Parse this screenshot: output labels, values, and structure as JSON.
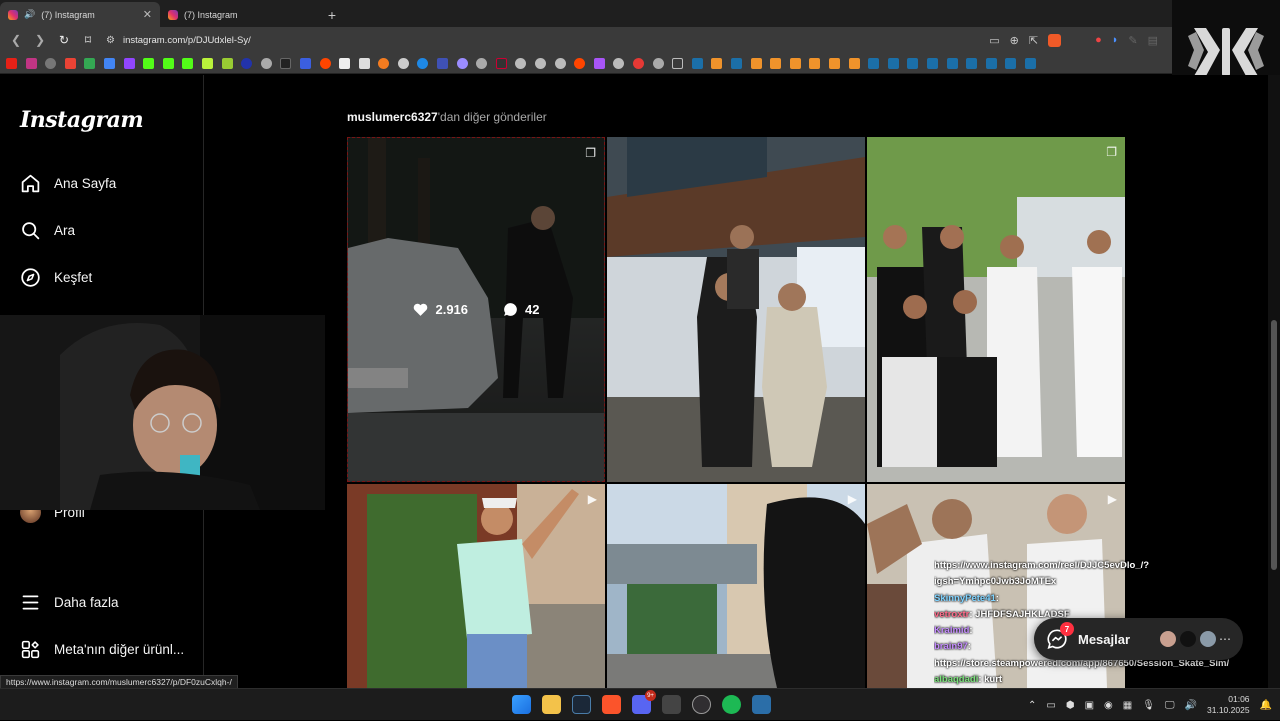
{
  "browser": {
    "tabs": [
      {
        "title": "(7) Instagram",
        "active": true
      },
      {
        "title": "(7) Instagram",
        "active": false
      }
    ],
    "new_tab": "+",
    "url": "instagram.com/p/DJUdxlel-Sy/",
    "status_url": "https://www.instagram.com/muslumerc6327/p/DF0zuCxlqh-/"
  },
  "sidebar": {
    "logo": "Instagram",
    "items": [
      {
        "label": "Ana Sayfa",
        "icon": "home-icon"
      },
      {
        "label": "Ara",
        "icon": "search-icon"
      },
      {
        "label": "Keşfet",
        "icon": "compass-icon"
      },
      {
        "label": "Profil",
        "icon": "avatar"
      },
      {
        "label": "Daha fazla",
        "icon": "menu-icon"
      },
      {
        "label": "Meta'nın diğer ürünl...",
        "icon": "meta-apps-icon"
      }
    ]
  },
  "main": {
    "more_posts_user": "muslumerc6327",
    "more_posts_suffix": "'dan diğer gönderiler",
    "posts": [
      {
        "likes": "2.916",
        "comments": "42",
        "hovered": true,
        "type": "carousel"
      },
      {
        "hovered": false,
        "type": "photo"
      },
      {
        "hovered": false,
        "type": "carousel"
      },
      {
        "hovered": false,
        "type": "reel"
      },
      {
        "hovered": false,
        "type": "reel"
      },
      {
        "hovered": false,
        "type": "reel"
      }
    ]
  },
  "messages": {
    "label": "Mesajlar",
    "badge": "7"
  },
  "chat": [
    {
      "user": "",
      "text": "https://www.instagram.com/reel/DJJC5evDlo_/?"
    },
    {
      "user": "",
      "text": "igsh=Ymhpc0Jwb3JoMTEx"
    },
    {
      "user": "SkinnyPete41",
      "text": ":"
    },
    {
      "user": "vetroxtr",
      "text": ": JHFDFSAJHKLADSF"
    },
    {
      "user": "Kralmid",
      "text": ":"
    },
    {
      "user": "brain97",
      "text": ":"
    },
    {
      "user": "",
      "text": "https://store.steampowered.com/app/867650/Session_Skate_Sim/"
    },
    {
      "user": "albaqdadi",
      "text": ": kurt"
    }
  ],
  "taskbar": {
    "time": "01:06",
    "date": "31.10.2025",
    "discord_badge": "9+"
  },
  "colors": {
    "accent_red": "#ff3040",
    "bg": "#000000",
    "sidebar_border": "#262626"
  }
}
